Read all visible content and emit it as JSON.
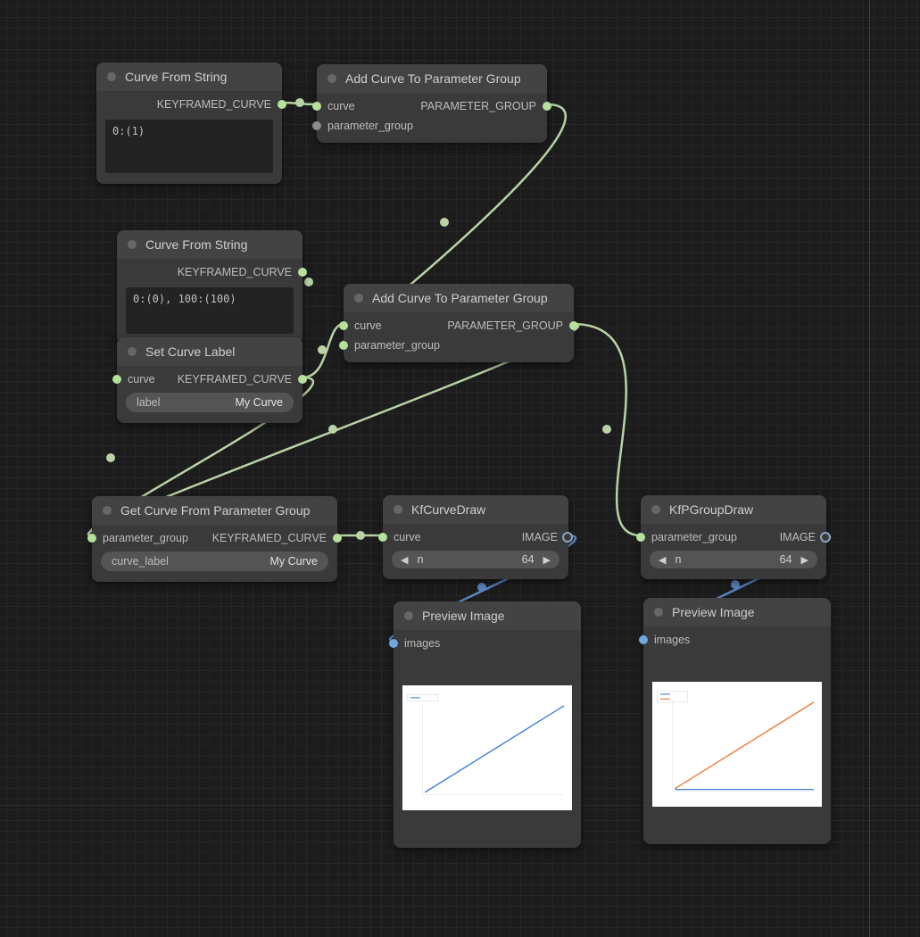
{
  "nodes": {
    "cfs1": {
      "title": "Curve From String",
      "out": "KEYFRAMED_CURVE",
      "code": "0:(1)"
    },
    "cfs2": {
      "title": "Curve From String",
      "out": "KEYFRAMED_CURVE",
      "code": "0:(0), 100:(100)"
    },
    "scl": {
      "title": "Set Curve Label",
      "in1": "curve",
      "out": "KEYFRAMED_CURVE",
      "field_k": "label",
      "field_v": "My Curve"
    },
    "acpg1": {
      "title": "Add Curve To Parameter Group",
      "in1": "curve",
      "in2": "parameter_group",
      "out": "PARAMETER_GROUP"
    },
    "acpg2": {
      "title": "Add Curve To Parameter Group",
      "in1": "curve",
      "in2": "parameter_group",
      "out": "PARAMETER_GROUP"
    },
    "gcpg": {
      "title": "Get Curve From Parameter Group",
      "in1": "parameter_group",
      "out": "KEYFRAMED_CURVE",
      "field_k": "curve_label",
      "field_v": "My Curve"
    },
    "kcd": {
      "title": "KfCurveDraw",
      "in1": "curve",
      "out": "IMAGE",
      "n_label": "n",
      "n_val": "64"
    },
    "kgd": {
      "title": "KfPGroupDraw",
      "in1": "parameter_group",
      "out": "IMAGE",
      "n_label": "n",
      "n_val": "64"
    },
    "pv1": {
      "title": "Preview Image",
      "in1": "images"
    },
    "pv2": {
      "title": "Preview Image",
      "in1": "images"
    }
  }
}
